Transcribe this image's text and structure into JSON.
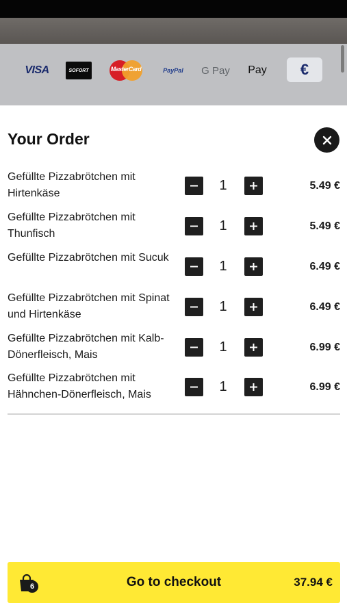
{
  "payment_methods": {
    "visa": "VISA",
    "sofort": "SOFORT",
    "mastercard": "MasterCard",
    "paypal": "PayPal",
    "gpay": "G Pay",
    "applepay": " Pay",
    "currency": "€"
  },
  "order": {
    "title": "Your Order",
    "close_icon": "close-icon",
    "items": [
      {
        "name": "Gefüllte Pizzabrötchen mit Hirtenkäse",
        "qty": "1",
        "price": "5.49 €"
      },
      {
        "name": "Gefüllte Pizzabrötchen mit Thunfisch",
        "qty": "1",
        "price": "5.49 €"
      },
      {
        "name": "Gefüllte Pizzabrötchen mit Sucuk",
        "qty": "1",
        "price": "6.49 €"
      },
      {
        "name": "Gefüllte Pizzabrötchen mit Spinat und Hirtenkäse",
        "qty": "1",
        "price": "6.49 €"
      },
      {
        "name": "Gefüllte Pizzabrötchen mit Kalb-Dönerfleisch, Mais",
        "qty": "1",
        "price": "6.99 €"
      },
      {
        "name": "Gefüllte Pizzabrötchen mit Hähnchen-Dönerfleisch, Mais",
        "qty": "1",
        "price": "6.99 €"
      }
    ]
  },
  "checkout": {
    "label": "Go to checkout",
    "total": "37.94 €",
    "bag_count": "6",
    "bag_icon": "shopping-bag-icon"
  },
  "colors": {
    "accent": "#ffe934",
    "dark": "#1f1f1f"
  }
}
